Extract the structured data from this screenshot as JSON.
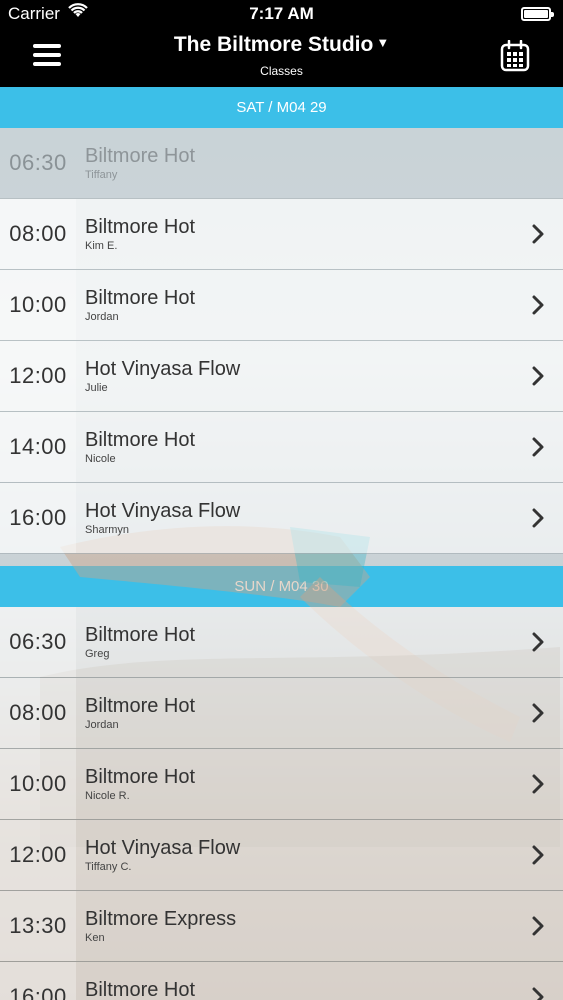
{
  "status": {
    "carrier": "Carrier",
    "time": "7:17 AM"
  },
  "nav": {
    "title": "The Biltmore Studio",
    "subtitle": "Classes"
  },
  "days": [
    {
      "date": "SAT / M04 29",
      "classes": [
        {
          "time": "06:30",
          "name": "Biltmore Hot",
          "instructor": "Tiffany"
        },
        {
          "time": "08:00",
          "name": "Biltmore Hot",
          "instructor": "Kim E."
        },
        {
          "time": "10:00",
          "name": "Biltmore Hot",
          "instructor": "Jordan"
        },
        {
          "time": "12:00",
          "name": "Hot Vinyasa Flow",
          "instructor": "Julie"
        },
        {
          "time": "14:00",
          "name": "Biltmore Hot",
          "instructor": "Nicole"
        },
        {
          "time": "16:00",
          "name": "Hot Vinyasa Flow",
          "instructor": "Sharmyn"
        }
      ]
    },
    {
      "date": "SUN / M04 30",
      "classes": [
        {
          "time": "06:30",
          "name": "Biltmore Hot",
          "instructor": "Greg"
        },
        {
          "time": "08:00",
          "name": "Biltmore Hot",
          "instructor": "Jordan"
        },
        {
          "time": "10:00",
          "name": "Biltmore Hot",
          "instructor": "Nicole R."
        },
        {
          "time": "12:00",
          "name": "Hot Vinyasa Flow",
          "instructor": "Tiffany C."
        },
        {
          "time": "13:30",
          "name": "Biltmore Express",
          "instructor": "Ken"
        },
        {
          "time": "16:00",
          "name": "Biltmore Hot",
          "instructor": ""
        }
      ]
    }
  ],
  "colors": {
    "accent": "#3cbfe8",
    "nav": "#000000"
  },
  "icons": {
    "menu": "menu-icon",
    "calendar": "calendar-icon",
    "chevron": "chevron-right-icon",
    "wifi": "wifi-icon",
    "battery": "battery-icon"
  }
}
